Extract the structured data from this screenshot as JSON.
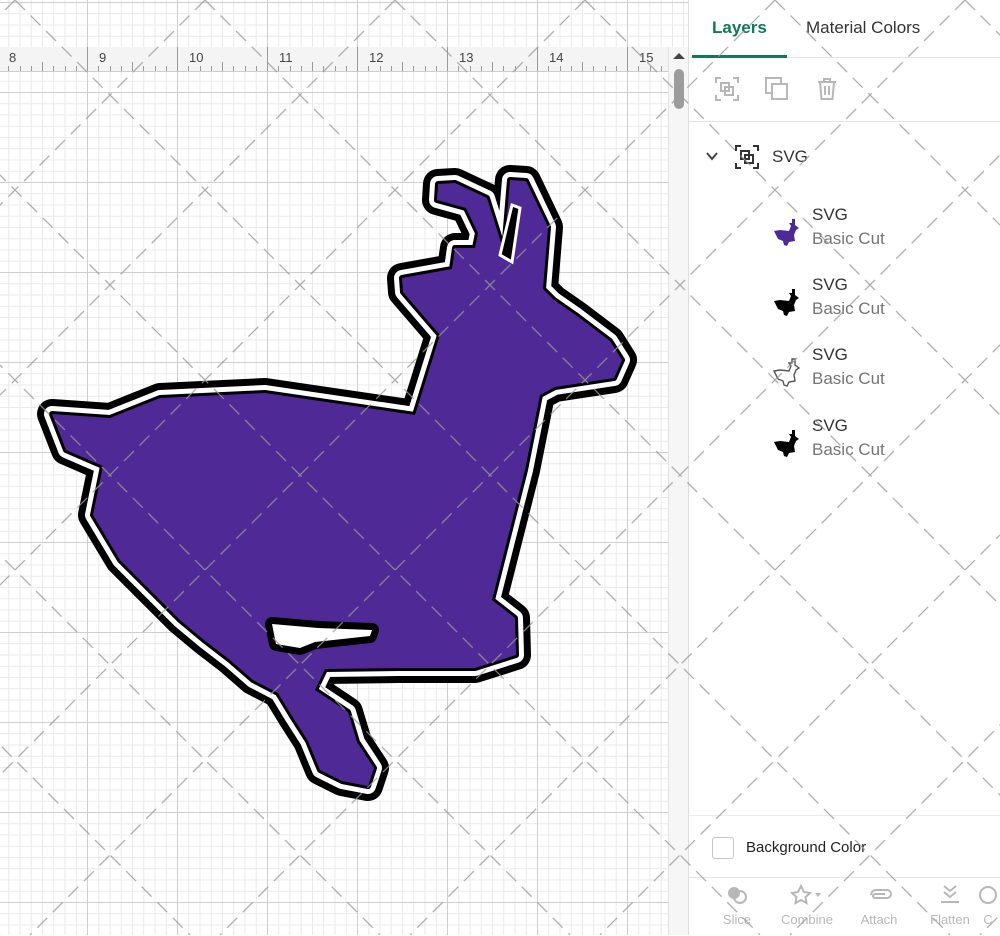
{
  "ruler": {
    "marks": [
      "8",
      "9",
      "10",
      "11",
      "12",
      "13",
      "14",
      "15"
    ]
  },
  "design": {
    "fill_color": "#4f2a96",
    "outline_color": "#000000",
    "inner_stroke_color": "#ffffff"
  },
  "panel": {
    "tabs": [
      {
        "label": "Layers",
        "active": true
      },
      {
        "label": "Material Colors",
        "active": false
      }
    ],
    "toolbar_icons": [
      "group-icon",
      "duplicate-icon",
      "delete-icon"
    ],
    "group": {
      "label": "SVG",
      "expanded": true
    },
    "layers": [
      {
        "name": "SVG",
        "operation": "Basic Cut",
        "thumb_color": "#4f2a96",
        "thumb_style": "filled"
      },
      {
        "name": "SVG",
        "operation": "Basic Cut",
        "thumb_color": "#000000",
        "thumb_style": "filled"
      },
      {
        "name": "SVG",
        "operation": "Basic Cut",
        "thumb_color": "#ffffff",
        "thumb_style": "outline"
      },
      {
        "name": "SVG",
        "operation": "Basic Cut",
        "thumb_color": "#000000",
        "thumb_style": "filled"
      }
    ],
    "background_color": {
      "label": "Background Color",
      "checked": false
    },
    "bottom_actions": [
      "Slice",
      "Combine",
      "Attach",
      "Flatten",
      "C"
    ]
  },
  "accent_color": "#0f7a57"
}
